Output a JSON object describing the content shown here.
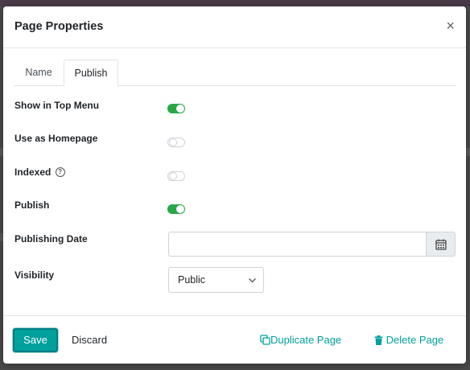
{
  "dialog": {
    "title": "Page Properties",
    "close_glyph": "×"
  },
  "tabs": [
    {
      "label": "Name",
      "active": false
    },
    {
      "label": "Publish",
      "active": true
    }
  ],
  "fields": {
    "show_in_top_menu": {
      "label": "Show in Top Menu",
      "enabled": true
    },
    "use_as_homepage": {
      "label": "Use as Homepage",
      "enabled": false
    },
    "indexed": {
      "label": "Indexed",
      "help_glyph": "?",
      "enabled": false
    },
    "publish": {
      "label": "Publish",
      "enabled": true
    },
    "publishing_date": {
      "label": "Publishing Date",
      "value": "",
      "button_icon": "calendar-icon"
    },
    "visibility": {
      "label": "Visibility",
      "value": "Public",
      "icon": "chevron-down-icon"
    }
  },
  "footer": {
    "save_label": "Save",
    "discard_label": "Discard",
    "duplicate_label": "Duplicate Page",
    "duplicate_icon": "copy-icon",
    "delete_label": "Delete Page",
    "delete_icon": "trash-icon"
  },
  "colors": {
    "accent": "#00a09d",
    "toggle_on": "#28a745",
    "top_bar": "#4b3a47"
  }
}
